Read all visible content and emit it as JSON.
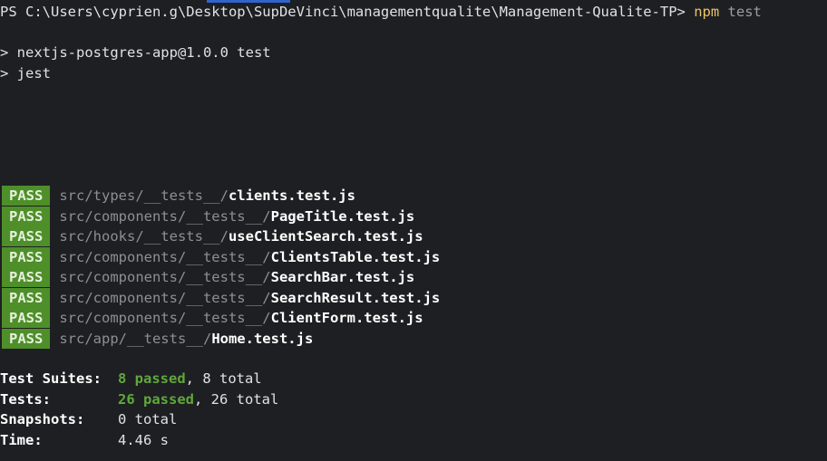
{
  "prompt": {
    "prefix": "PS C:\\Users\\cyprien.g\\Desktop\\SupDeVinci\\managementqualite\\Management-Qualite-TP> ",
    "command": "npm",
    "argument": " test"
  },
  "output": {
    "script_line": "> nextjs-postgres-app@1.0.0 test",
    "runner_line": "> jest"
  },
  "results": [
    {
      "status": "PASS",
      "dir": "src/types/__tests__/",
      "file": "clients.test.js"
    },
    {
      "status": "PASS",
      "dir": "src/components/__tests__/",
      "file": "PageTitle.test.js"
    },
    {
      "status": "PASS",
      "dir": "src/hooks/__tests__/",
      "file": "useClientSearch.test.js"
    },
    {
      "status": "PASS",
      "dir": "src/components/__tests__/",
      "file": "ClientsTable.test.js"
    },
    {
      "status": "PASS",
      "dir": "src/components/__tests__/",
      "file": "SearchBar.test.js"
    },
    {
      "status": "PASS",
      "dir": "src/components/__tests__/",
      "file": "SearchResult.test.js"
    },
    {
      "status": "PASS",
      "dir": "src/components/__tests__/",
      "file": "ClientForm.test.js"
    },
    {
      "status": "PASS",
      "dir": "src/app/__tests__/",
      "file": "Home.test.js"
    }
  ],
  "summary": {
    "suites_label": "Test Suites:",
    "suites_passed": "8 passed",
    "suites_total": ", 8 total",
    "tests_label": "Tests:",
    "tests_passed": "26 passed",
    "tests_total": ", 26 total",
    "snapshots_label": "Snapshots:",
    "snapshots_value": "0 total",
    "time_label": "Time:",
    "time_value": "4.46 s"
  },
  "colors": {
    "background": "#1e1f22",
    "pass_badge": "#4e8f2a",
    "passed_text": "#5fa83a",
    "command": "#e8c46a"
  }
}
